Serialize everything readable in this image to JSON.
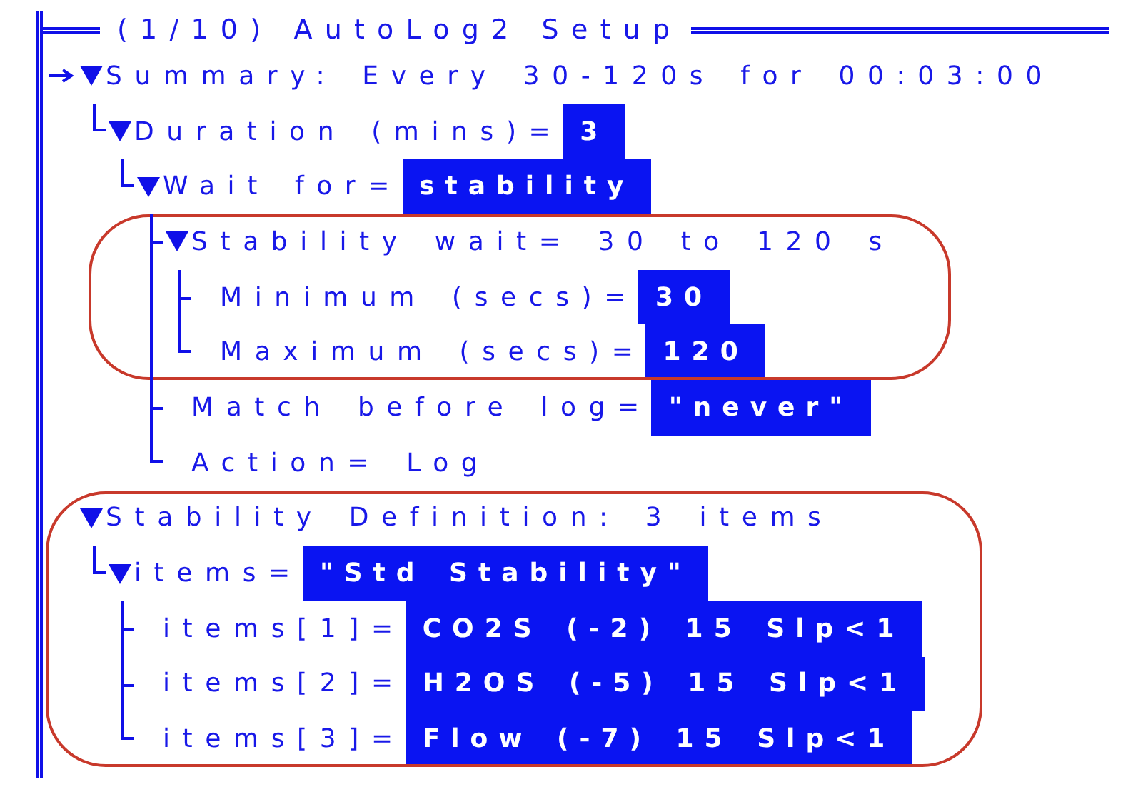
{
  "title": "(1/10) AutoLog2 Setup",
  "rows": [
    {
      "label": "Summary: Every 30-120s for 00:03:00",
      "selected": true,
      "expanded": true,
      "circled": false,
      "children": [
        {
          "label": "Duration (mins)=",
          "value": "3",
          "selected": false,
          "expanded": true,
          "circled": false,
          "children": [
            {
              "label": "Wait for=",
              "value": "stability",
              "selected": false,
              "expanded": true,
              "circled": false,
              "children": [
                {
                  "label": "Stability wait= 30 to 120 s",
                  "selected": false,
                  "expanded": true,
                  "circled": true,
                  "children": [
                    {
                      "label": "Minimum (secs)=",
                      "value": "30",
                      "selected": false,
                      "circled": false
                    },
                    {
                      "label": "Maximum (secs)=",
                      "value": "120",
                      "selected": false,
                      "circled": false
                    }
                  ]
                },
                {
                  "label": "Match before log=",
                  "value": "\"never\"",
                  "selected": false,
                  "circled": false
                },
                {
                  "label": "Action= Log",
                  "selected": false,
                  "circled": false
                }
              ]
            }
          ]
        }
      ]
    },
    {
      "label": "Stability Definition: 3 items",
      "selected": false,
      "expanded": true,
      "circled": true,
      "children": [
        {
          "label": "items=",
          "value": "\"Std Stability\"",
          "selected": false,
          "expanded": true,
          "circled": false,
          "children": [
            {
              "label": "items[1]=",
              "value": "CO2S (-2) 15 Slp<1",
              "selected": false,
              "circled": false
            },
            {
              "label": "items[2]=",
              "value": "H2OS (-5) 15 Slp<1",
              "selected": false,
              "circled": false
            },
            {
              "label": "items[3]=",
              "value": "Flow (-7) 15 Slp<1",
              "selected": false,
              "circled": false
            }
          ]
        }
      ]
    }
  ]
}
